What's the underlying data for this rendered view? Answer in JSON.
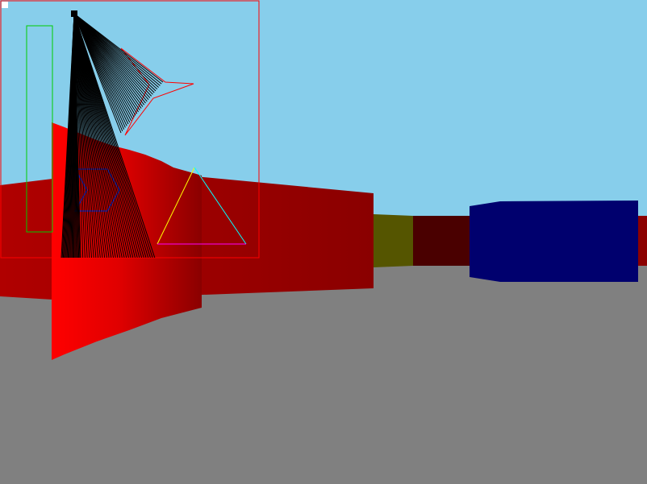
{
  "scene": {
    "kind": "raycaster-3d-view",
    "sky_color": "#87CEEB",
    "floor_color": "#808080",
    "wall_colors": {
      "near_red": "#FF0000",
      "dark_red": "#8B0000",
      "olive": "#555500",
      "maroon": "#4A0000",
      "navy": "#00006E"
    }
  },
  "minimap": {
    "border_color": "#FF0000",
    "player_color": "#000000",
    "ray_color": "#000000",
    "shapes": {
      "green_rect_color": "#00CC00",
      "red_arrow_color": "#FF0000",
      "blue_chevron_color": "#3333FF",
      "triangle_colors": [
        "#FFFF00",
        "#00FFFF",
        "#FF00FF"
      ]
    }
  }
}
